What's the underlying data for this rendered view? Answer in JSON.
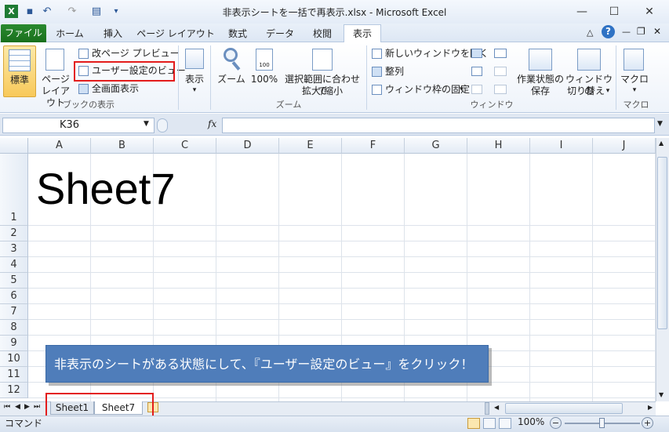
{
  "window": {
    "title": "非表示シートを一括で再表示.xlsx - Microsoft Excel"
  },
  "tabs": [
    "ファイル",
    "ホーム",
    "挿入",
    "ページ レイアウト",
    "数式",
    "データ",
    "校閲",
    "表示"
  ],
  "ribbon": {
    "workbook_views": {
      "normal": "標準",
      "page_layout": [
        "ページ",
        "レイアウト"
      ],
      "page_break_preview": "改ページ プレビュー",
      "custom_views": "ユーザー設定のビュー",
      "full_screen": "全画面表示",
      "group_label": "ブックの表示"
    },
    "show": {
      "label": "表示"
    },
    "zoom": {
      "zoom": "ズーム",
      "zoom100": "100%",
      "zoom_selection": [
        "選択範囲に合わせて",
        "拡大/縮小"
      ],
      "group_label": "ズーム"
    },
    "window": {
      "new_window": "新しいウィンドウを開く",
      "arrange": "整列",
      "freeze": "ウィンドウ枠の固定",
      "save_workspace": [
        "作業状態の",
        "保存"
      ],
      "switch_windows": [
        "ウィンドウの",
        "切り替え"
      ],
      "group_label": "ウィンドウ"
    },
    "macros": {
      "label": "マクロ",
      "group_label": "マクロ"
    }
  },
  "formula_bar": {
    "name_box": "K36",
    "fx": "fx",
    "value": ""
  },
  "grid": {
    "columns": [
      "A",
      "B",
      "C",
      "D",
      "E",
      "F",
      "G",
      "H",
      "I",
      "J"
    ],
    "rows": [
      "1",
      "2",
      "3",
      "4",
      "5",
      "6",
      "7",
      "8",
      "9",
      "10",
      "11",
      "12"
    ],
    "cell_A1": "Sheet7"
  },
  "callout": {
    "text": "非表示のシートがある状態にして、『ユーザー設定のビュー』をクリック！"
  },
  "sheet_tabs": [
    "Sheet1",
    "Sheet7"
  ],
  "status": {
    "mode": "コマンド",
    "zoom": "100%"
  },
  "colors": {
    "accent": "#4f7dba",
    "highlight": "#e31c1c",
    "file_tab": "#1f7a24"
  }
}
